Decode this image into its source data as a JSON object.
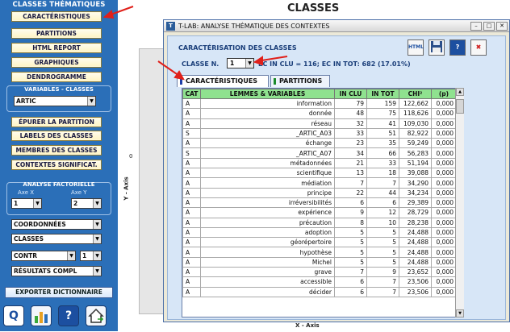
{
  "left_panel": {
    "title": "CLASSES THÉMATIQUES",
    "buttons": [
      {
        "label": "CARACTÉRISTIQUES"
      },
      {
        "label": "PARTITIONS"
      },
      {
        "label": "HTML REPORT"
      },
      {
        "label": "GRAPHIQUES"
      },
      {
        "label": "DENDROGRAMME"
      }
    ],
    "variables_label": "VARIABLES - CLASSES",
    "variable_select": "ARTIC",
    "buttons2": [
      {
        "label": "ÉPURER LA PARTITION"
      },
      {
        "label": "LABELS DES CLASSES"
      },
      {
        "label": "MEMBRES DES CLASSES"
      },
      {
        "label": "CONTEXTES SIGNIFICAT."
      }
    ],
    "factorial_label": "ANALYSE FACTORIELLE",
    "axe_x_label": "Axe X",
    "axe_y_label": "Axe Y",
    "axe_x_value": "1",
    "axe_y_value": "2",
    "select_coord": "COORDONNÉES",
    "select_classes": "CLASSES",
    "select_contr": "CONTR",
    "select_contr_num": "1",
    "select_resultats": "RÉSULTATS COMPL",
    "export_label": "EXPORTER DICTIONNAIRE",
    "bottom_icons": [
      "Q",
      "",
      "?",
      ""
    ]
  },
  "chart": {
    "title": "CLASSES",
    "zero_label": "0",
    "y_axis": "Y - Axis",
    "x_axis": "X - Axis"
  },
  "dialog": {
    "title": "T-LAB: ANALYSE THÉMATIQUE DES CONTEXTES",
    "heading": "CARACTÉRISATION DES CLASSES",
    "classe_label": "CLASSE  N.",
    "classe_value": "1",
    "ec_info": "EC IN CLU = 116; EC IN TOT: 682 (17.01%)",
    "tabs": [
      "CARACTÉRISTIQUES",
      "PARTITIONS"
    ],
    "toolbar": [
      "HTML",
      "",
      "?",
      "✖"
    ],
    "table": {
      "headers": [
        "CAT",
        "LEMMES & VARIABLES",
        "IN CLU",
        "IN TOT",
        "CHI²",
        "(p)"
      ],
      "rows": [
        [
          "A",
          "information",
          "79",
          "159",
          "122,662",
          "0,000"
        ],
        [
          "A",
          "donnée",
          "48",
          "75",
          "118,626",
          "0,000"
        ],
        [
          "A",
          "réseau",
          "32",
          "41",
          "109,030",
          "0,000"
        ],
        [
          "S",
          "_ARTIC_A03",
          "33",
          "51",
          "82,922",
          "0,000"
        ],
        [
          "A",
          "échange",
          "23",
          "35",
          "59,249",
          "0,000"
        ],
        [
          "S",
          "_ARTIC_A07",
          "34",
          "66",
          "56,283",
          "0,000"
        ],
        [
          "A",
          "métadonnées",
          "21",
          "33",
          "51,194",
          "0,000"
        ],
        [
          "A",
          "scientifique",
          "13",
          "18",
          "39,088",
          "0,000"
        ],
        [
          "A",
          "médiation",
          "7",
          "7",
          "34,290",
          "0,000"
        ],
        [
          "A",
          "principe",
          "22",
          "44",
          "34,234",
          "0,000"
        ],
        [
          "A",
          "irréversibilités",
          "6",
          "6",
          "29,389",
          "0,000"
        ],
        [
          "A",
          "expérience",
          "9",
          "12",
          "28,729",
          "0,000"
        ],
        [
          "A",
          "précaution",
          "8",
          "10",
          "28,238",
          "0,000"
        ],
        [
          "A",
          "adoption",
          "5",
          "5",
          "24,488",
          "0,000"
        ],
        [
          "A",
          "géorépertoire",
          "5",
          "5",
          "24,488",
          "0,000"
        ],
        [
          "A",
          "hypothèse",
          "5",
          "5",
          "24,488",
          "0,000"
        ],
        [
          "A",
          "Michel",
          "5",
          "5",
          "24,488",
          "0,000"
        ],
        [
          "A",
          "grave",
          "7",
          "9",
          "23,652",
          "0,000"
        ],
        [
          "A",
          "accessible",
          "6",
          "7",
          "23,506",
          "0,000"
        ],
        [
          "A",
          "décider",
          "6",
          "7",
          "23,506",
          "0,000"
        ]
      ]
    }
  },
  "colors": {
    "panel_blue": "#2b6fb8",
    "header_green": "#8fe28f",
    "arrow_red": "#e0201a",
    "tab_blue_mark": "#1f3fa8",
    "tab_green_mark": "#1a8a2a"
  }
}
